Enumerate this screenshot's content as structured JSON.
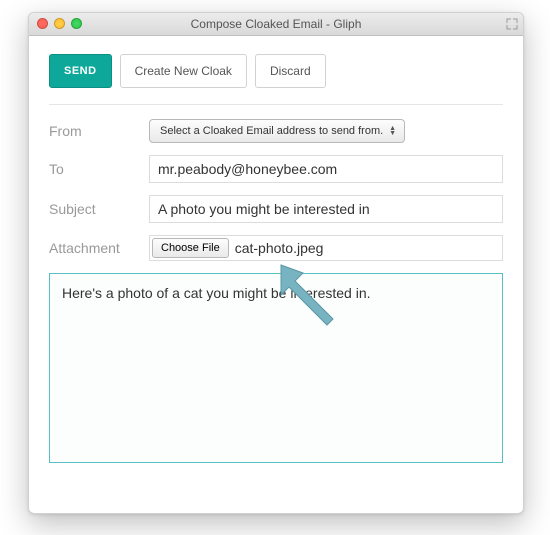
{
  "window": {
    "title": "Compose Cloaked Email - Gliph"
  },
  "toolbar": {
    "send_label": "SEND",
    "create_cloak_label": "Create New Cloak",
    "discard_label": "Discard"
  },
  "form": {
    "from": {
      "label": "From",
      "select_label": "Select a Cloaked Email address to send from."
    },
    "to": {
      "label": "To",
      "value": "mr.peabody@honeybee.com"
    },
    "subject": {
      "label": "Subject",
      "value": "A photo you might be interested in"
    },
    "attachment": {
      "label": "Attachment",
      "choose_file_label": "Choose File",
      "filename": "cat-photo.jpeg"
    }
  },
  "body": {
    "text": "Here's a photo of a cat you might be interested in."
  },
  "colors": {
    "accent": "#0ea89a",
    "editor_border": "#59c0c6",
    "arrow": "#78b3c1"
  }
}
